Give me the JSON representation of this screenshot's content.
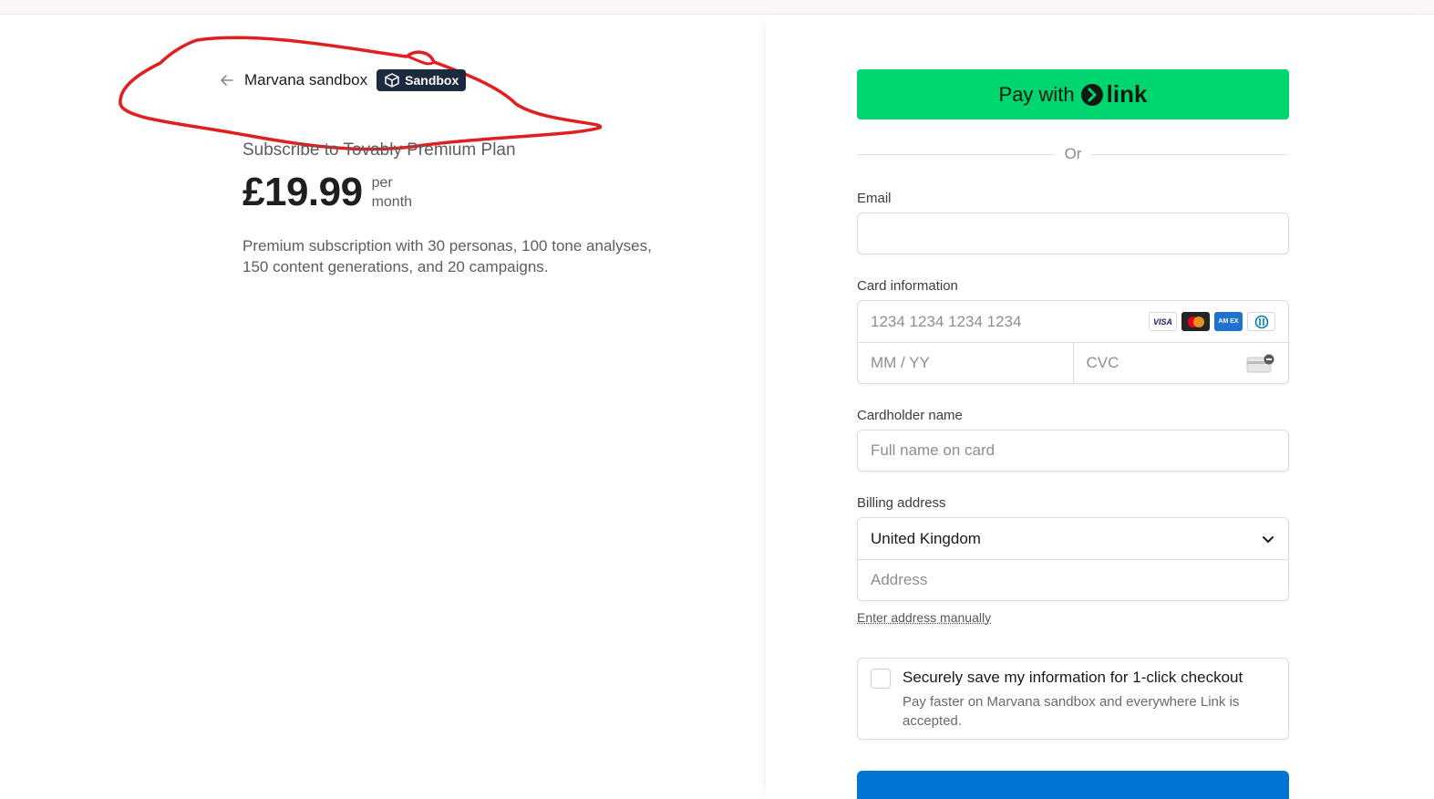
{
  "header": {
    "merchant_name": "Marvana sandbox",
    "badge_label": "Sandbox",
    "back_icon": "arrow-left-icon",
    "annotation_color": "#e02020"
  },
  "product": {
    "title": "Subscribe to Tovably Premium Plan",
    "price": "£19.99",
    "period_line1": "per",
    "period_line2": "month",
    "description": "Premium subscription with 30 personas, 100 tone analyses, 150 content generations, and 20 campaigns."
  },
  "payment": {
    "link_button": {
      "prefix": "Pay with",
      "brand": "link",
      "color": "#00d66f"
    },
    "separator": "Or",
    "email": {
      "label": "Email",
      "value": "",
      "placeholder": ""
    },
    "card": {
      "label": "Card information",
      "number_placeholder": "1234 1234 1234 1234",
      "expiry_placeholder": "MM / YY",
      "cvc_placeholder": "CVC",
      "brands": [
        "visa",
        "mastercard",
        "amex",
        "diners"
      ],
      "visa_text": "VISA",
      "amex_text": "AM EX"
    },
    "cardholder": {
      "label": "Cardholder name",
      "placeholder": "Full name on card"
    },
    "billing": {
      "label": "Billing address",
      "country": "United Kingdom",
      "address_placeholder": "Address",
      "manual_link": "Enter address manually"
    },
    "save": {
      "title": "Securely save my information for 1-click checkout",
      "description": "Pay faster on Marvana sandbox and everywhere Link is accepted.",
      "checked": false
    },
    "submit": {
      "label": "",
      "color": "#0074d4"
    }
  }
}
